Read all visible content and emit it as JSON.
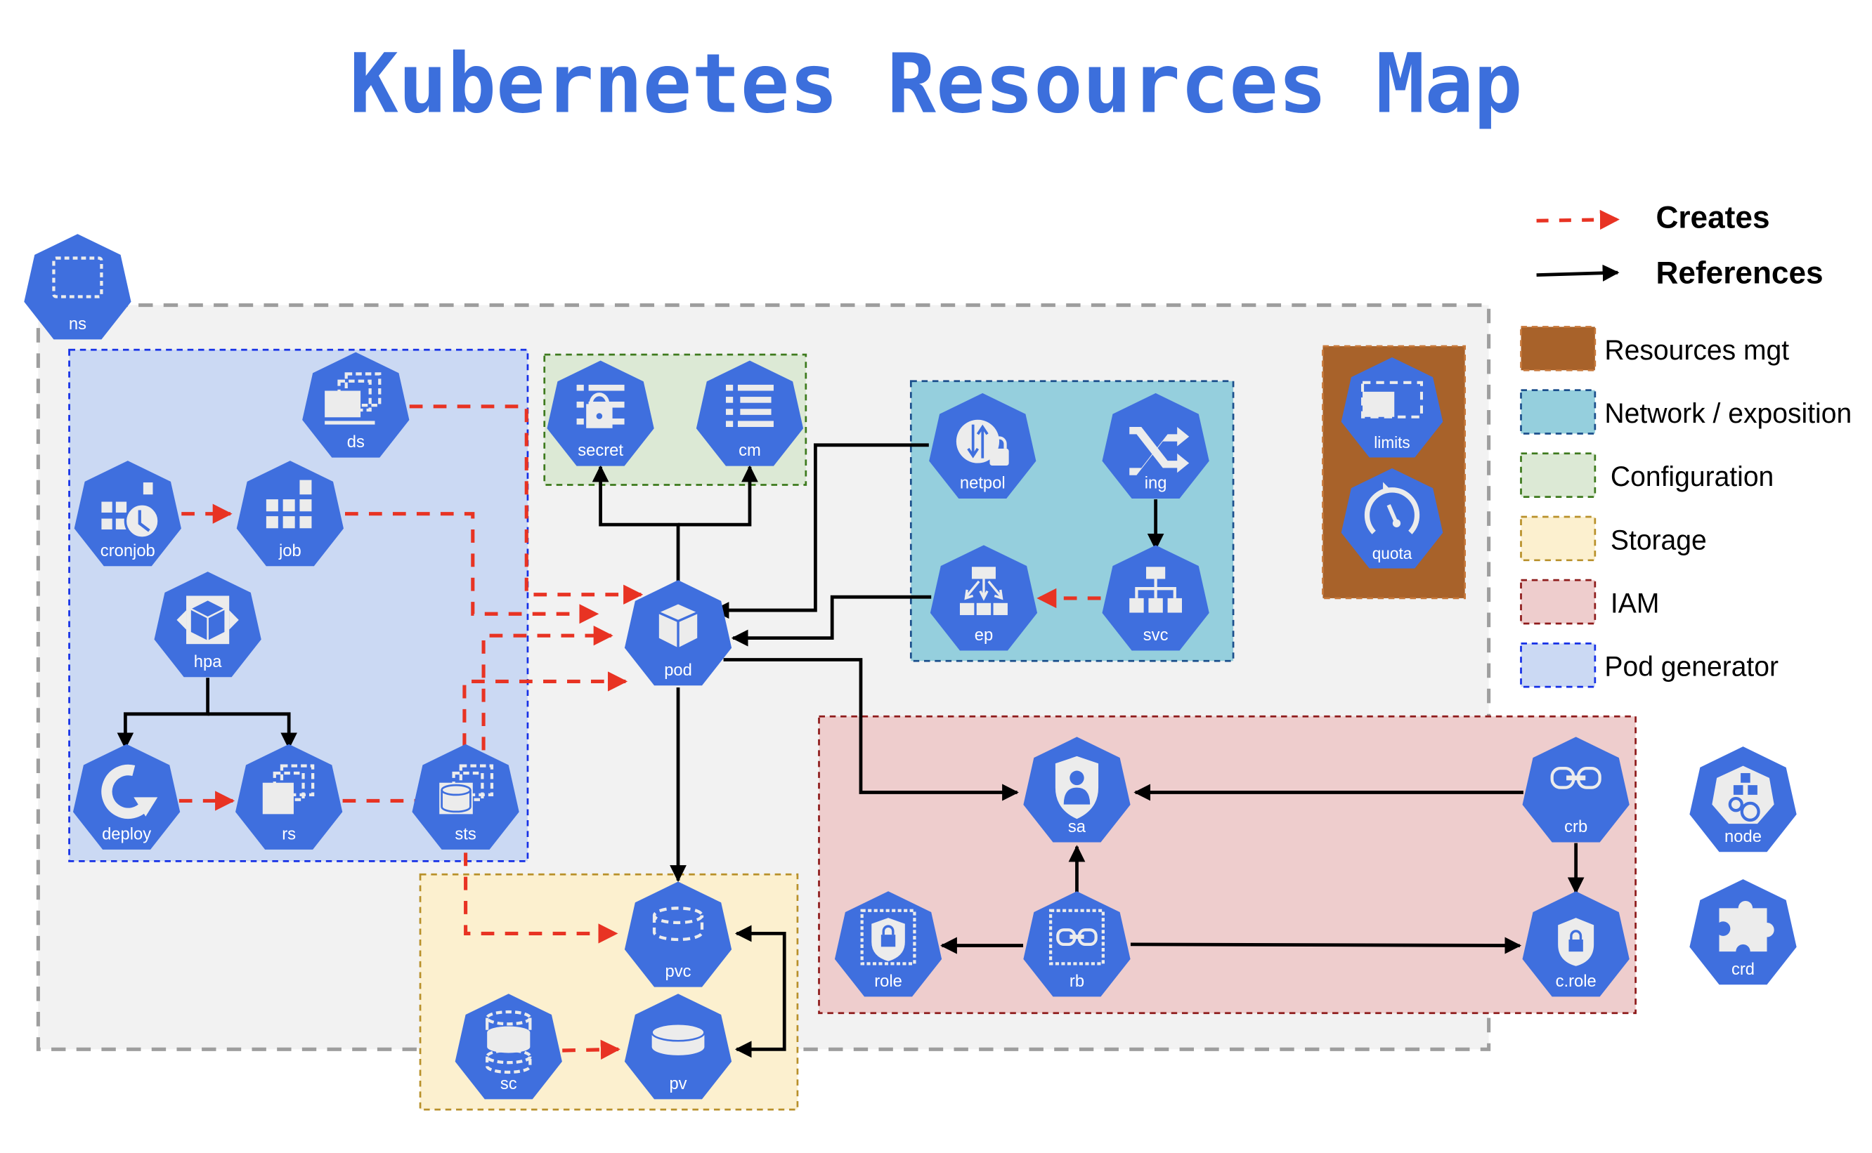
{
  "title": "Kubernetes Resources Map",
  "legend": {
    "edges": [
      {
        "label": "Creates",
        "style": "dashed-red"
      },
      {
        "label": "References",
        "style": "solid-black"
      }
    ],
    "groups": [
      {
        "key": "resources",
        "label": "Resources mgt",
        "fill": "#a8622a",
        "border": "#c7783a"
      },
      {
        "key": "network",
        "label": "Network / exposition",
        "fill": "#95cfdd",
        "border": "#1b4f8c"
      },
      {
        "key": "config",
        "label": "Configuration",
        "fill": "#dce9d5",
        "border": "#3d7a1d"
      },
      {
        "key": "storage",
        "label": "Storage",
        "fill": "#fcf0cf",
        "border": "#b8902a"
      },
      {
        "key": "iam",
        "label": "IAM",
        "fill": "#eecdcd",
        "border": "#8e1b1b"
      },
      {
        "key": "podgen",
        "label": "Pod generator",
        "fill": "#cbd9f3",
        "border": "#1530e6"
      }
    ]
  },
  "namespace": {
    "fill": "#f2f2f2",
    "border": "#9e9e9e"
  },
  "colors": {
    "node": "#3f6fde",
    "creates": "#e83323",
    "references": "#000000",
    "title": "#3c6fdc"
  },
  "nodes": {
    "ns": {
      "label": "ns",
      "icon": "namespace-icon"
    },
    "ds": {
      "label": "ds",
      "icon": "daemonset-icon",
      "group": "podgen"
    },
    "cronjob": {
      "label": "cronjob",
      "icon": "cronjob-icon",
      "group": "podgen"
    },
    "job": {
      "label": "job",
      "icon": "job-icon",
      "group": "podgen"
    },
    "hpa": {
      "label": "hpa",
      "icon": "hpa-icon",
      "group": "podgen"
    },
    "deploy": {
      "label": "deploy",
      "icon": "deployment-icon",
      "group": "podgen"
    },
    "rs": {
      "label": "rs",
      "icon": "replicaset-icon",
      "group": "podgen"
    },
    "sts": {
      "label": "sts",
      "icon": "statefulset-icon",
      "group": "podgen"
    },
    "secret": {
      "label": "secret",
      "icon": "secret-icon",
      "group": "config"
    },
    "cm": {
      "label": "cm",
      "icon": "configmap-icon",
      "group": "config"
    },
    "pod": {
      "label": "pod",
      "icon": "pod-icon"
    },
    "netpol": {
      "label": "netpol",
      "icon": "network-policy-icon",
      "group": "network"
    },
    "ing": {
      "label": "ing",
      "icon": "ingress-icon",
      "group": "network"
    },
    "ep": {
      "label": "ep",
      "icon": "endpoints-icon",
      "group": "network"
    },
    "svc": {
      "label": "svc",
      "icon": "service-icon",
      "group": "network"
    },
    "limits": {
      "label": "limits",
      "icon": "limits-icon",
      "group": "resources"
    },
    "quota": {
      "label": "quota",
      "icon": "quota-icon",
      "group": "resources"
    },
    "sa": {
      "label": "sa",
      "icon": "service-account-icon",
      "group": "iam"
    },
    "crb": {
      "label": "crb",
      "icon": "cluster-role-binding-icon",
      "group": "iam"
    },
    "role": {
      "label": "role",
      "icon": "role-icon",
      "group": "iam"
    },
    "rb": {
      "label": "rb",
      "icon": "role-binding-icon",
      "group": "iam"
    },
    "crole": {
      "label": "c.role",
      "icon": "cluster-role-icon",
      "group": "iam"
    },
    "node": {
      "label": "node",
      "icon": "node-icon"
    },
    "crd": {
      "label": "crd",
      "icon": "crd-icon"
    },
    "pvc": {
      "label": "pvc",
      "icon": "pvc-icon",
      "group": "storage"
    },
    "pv": {
      "label": "pv",
      "icon": "pv-icon",
      "group": "storage"
    },
    "sc": {
      "label": "sc",
      "icon": "storage-class-icon",
      "group": "storage"
    }
  },
  "edges": [
    {
      "from": "cronjob",
      "to": "job",
      "type": "creates"
    },
    {
      "from": "ds",
      "to": "pod",
      "type": "creates"
    },
    {
      "from": "job",
      "to": "pod",
      "type": "creates"
    },
    {
      "from": "rs",
      "to": "pod",
      "type": "creates"
    },
    {
      "from": "sts",
      "to": "pod",
      "type": "creates"
    },
    {
      "from": "deploy",
      "to": "rs",
      "type": "creates"
    },
    {
      "from": "hpa",
      "to": "deploy",
      "type": "references"
    },
    {
      "from": "hpa",
      "to": "rs",
      "type": "references"
    },
    {
      "from": "sts",
      "to": "pvc",
      "type": "creates"
    },
    {
      "from": "pod",
      "to": "secret",
      "type": "references"
    },
    {
      "from": "pod",
      "to": "cm",
      "type": "references"
    },
    {
      "from": "netpol",
      "to": "pod",
      "type": "references"
    },
    {
      "from": "ep",
      "to": "pod",
      "type": "references"
    },
    {
      "from": "ing",
      "to": "svc",
      "type": "references"
    },
    {
      "from": "svc",
      "to": "ep",
      "type": "creates"
    },
    {
      "from": "pod",
      "to": "pvc",
      "type": "references"
    },
    {
      "from": "pod",
      "to": "sa",
      "type": "references"
    },
    {
      "from": "crb",
      "to": "sa",
      "type": "references"
    },
    {
      "from": "crb",
      "to": "crole",
      "type": "references"
    },
    {
      "from": "rb",
      "to": "sa",
      "type": "references"
    },
    {
      "from": "rb",
      "to": "role",
      "type": "references"
    },
    {
      "from": "rb",
      "to": "crole",
      "type": "references"
    },
    {
      "from": "pv",
      "to": "pvc",
      "type": "references"
    },
    {
      "from": "pvc",
      "to": "pv",
      "type": "references"
    },
    {
      "from": "sc",
      "to": "pv",
      "type": "creates"
    }
  ]
}
